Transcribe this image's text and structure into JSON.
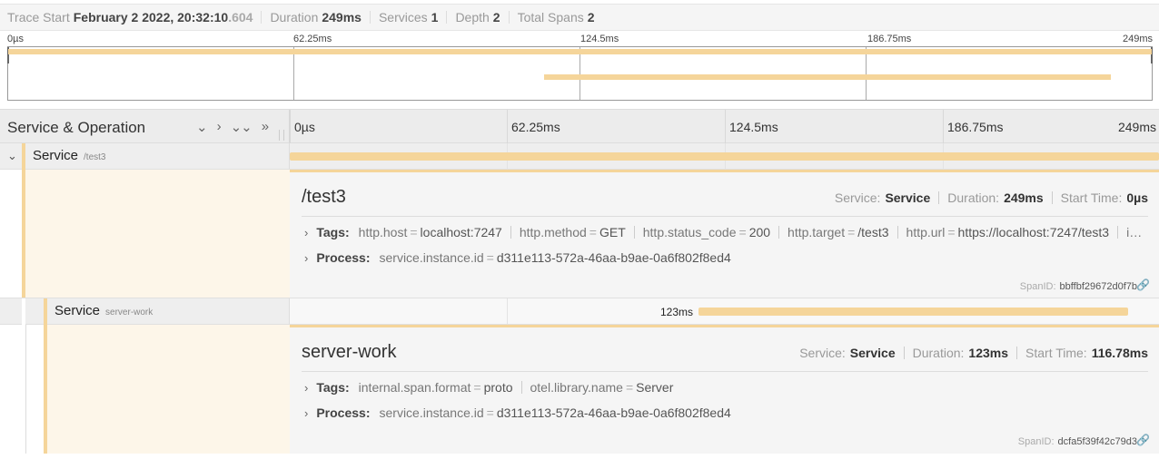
{
  "header": {
    "trace_start_label": "Trace Start",
    "trace_start_value": "February 2 2022, 20:32:10",
    "trace_start_ms": ".604",
    "duration_label": "Duration",
    "duration_value": "249ms",
    "services_label": "Services",
    "services_value": "1",
    "depth_label": "Depth",
    "depth_value": "2",
    "total_spans_label": "Total Spans",
    "total_spans_value": "2"
  },
  "ticks": [
    "0µs",
    "62.25ms",
    "124.5ms",
    "186.75ms",
    "249ms"
  ],
  "timeline": {
    "title": "Service & Operation",
    "controls": [
      "⌄",
      "›",
      "⌄⌄",
      "»"
    ]
  },
  "spans": [
    {
      "service": "Service",
      "operation": "/test3",
      "expand_icon": "⌄",
      "detail": {
        "title": "/test3",
        "service_label": "Service:",
        "service_value": "Service",
        "duration_label": "Duration:",
        "duration_value": "249ms",
        "start_label": "Start Time:",
        "start_value": "0µs",
        "tags_label": "Tags:",
        "tags": [
          {
            "k": "http.host",
            "v": "localhost:7247"
          },
          {
            "k": "http.method",
            "v": "GET"
          },
          {
            "k": "http.status_code",
            "v": "200"
          },
          {
            "k": "http.target",
            "v": "/test3"
          },
          {
            "k": "http.url",
            "v": "https://localhost:7247/test3"
          },
          {
            "k": "i…",
            "v": ""
          }
        ],
        "process_label": "Process:",
        "process": [
          {
            "k": "service.instance.id",
            "v": "d311e113-572a-46aa-b9ae-0a6f802f8ed4"
          }
        ],
        "spanid_label": "SpanID:",
        "spanid_value": "bbffbf29672d0f7b"
      }
    },
    {
      "service": "Service",
      "operation": "server-work",
      "duration_label": "123ms",
      "detail": {
        "title": "server-work",
        "service_label": "Service:",
        "service_value": "Service",
        "duration_label": "Duration:",
        "duration_value": "123ms",
        "start_label": "Start Time:",
        "start_value": "116.78ms",
        "tags_label": "Tags:",
        "tags": [
          {
            "k": "internal.span.format",
            "v": "proto"
          },
          {
            "k": "otel.library.name",
            "v": "Server"
          }
        ],
        "process_label": "Process:",
        "process": [
          {
            "k": "service.instance.id",
            "v": "d311e113-572a-46aa-b9ae-0a6f802f8ed4"
          }
        ],
        "spanid_label": "SpanID:",
        "spanid_value": "dcfa5f39f42c79d3"
      }
    }
  ],
  "icons": {
    "link": "link-icon",
    "chevron": "chevron-right-icon"
  }
}
